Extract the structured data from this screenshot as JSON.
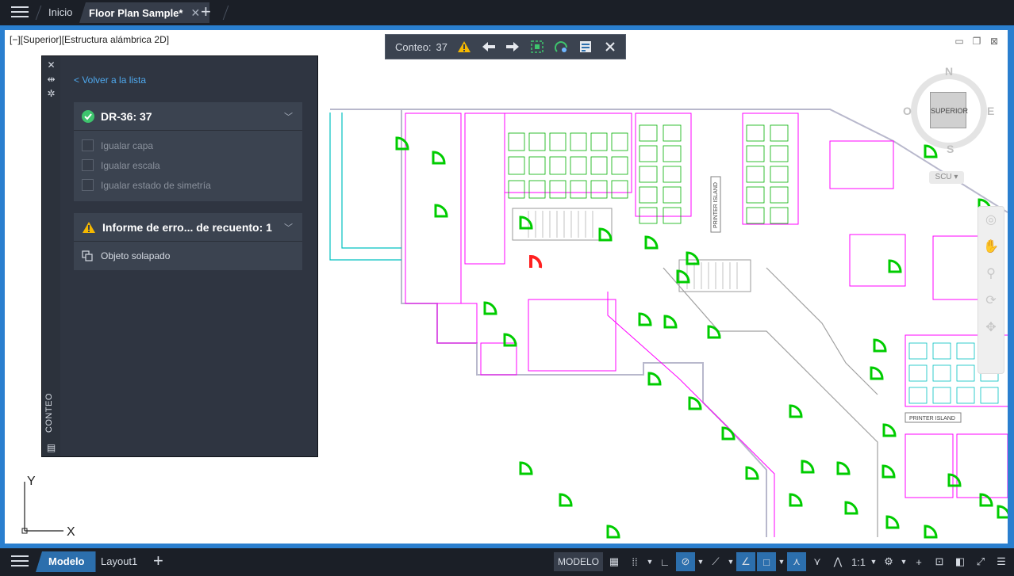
{
  "topbar": {
    "tabs": [
      {
        "label": "Inicio"
      },
      {
        "label": "Floor Plan Sample*",
        "close": "✕"
      }
    ],
    "new_tab": "+"
  },
  "viewport": {
    "view_label": "[−][Superior][Estructura alámbrica 2D]",
    "viewcube": {
      "face": "SUPERIOR",
      "north": "N",
      "south": "S",
      "east": "E",
      "west": "O"
    },
    "ucs_menu": "SCU ▾",
    "ucs": {
      "x": "X",
      "y": "Y"
    },
    "printer_label_vertical": "PRINTER ISLAND",
    "printer_label_horizontal": "PRINTER ISLAND"
  },
  "count_toolbar": {
    "label": "Conteo:",
    "value": "37"
  },
  "count_palette": {
    "title": "CONTEO",
    "back_link": "< Volver a la lista",
    "block_section": {
      "title": "DR-36: 37",
      "options": [
        "Igualar capa",
        "Igualar escala",
        "Igualar estado de simetría"
      ]
    },
    "error_section": {
      "title": "Informe de erro... de recuento: 1",
      "items": [
        "Objeto solapado"
      ]
    }
  },
  "statusbar": {
    "tabs": [
      {
        "label": "Modelo"
      },
      {
        "label": "Layout1"
      }
    ],
    "new_layout": "+",
    "model_button": "MODELO",
    "scale": "1:1"
  },
  "colors": {
    "accent": "#2c6fad",
    "link": "#4fa9ee",
    "success": "#3ec46d",
    "warning": "#f5b800",
    "door_blocks": "#00cc00",
    "partitions": "#ff00ff",
    "furniture": "#00c0c0"
  }
}
